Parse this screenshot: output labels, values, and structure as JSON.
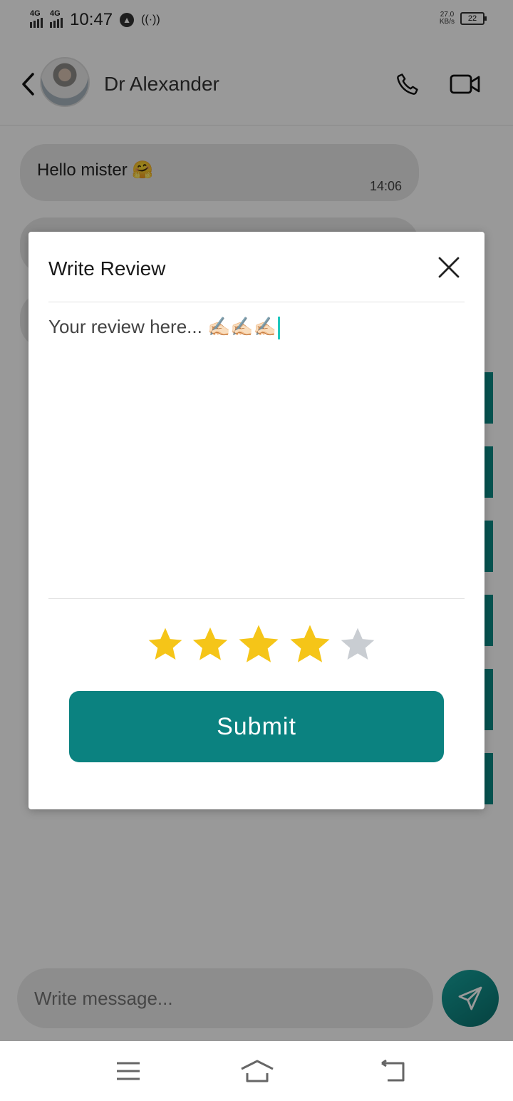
{
  "status_bar": {
    "network_1": "4G",
    "network_2": "4G",
    "time": "10:47",
    "speed_value": "27.0",
    "speed_unit": "KB/s",
    "battery": "22"
  },
  "header": {
    "contact_name": "Dr Alexander",
    "icons": [
      "back-arrow",
      "phone",
      "video-camera"
    ]
  },
  "messages": [
    {
      "text": "Hello mister 🤗",
      "time": "14:06"
    }
  ],
  "composer": {
    "placeholder": "Write message..."
  },
  "dialog": {
    "title": "Write Review",
    "review_placeholder": "Your review here... ✍🏻✍🏻✍🏻",
    "rating": 4,
    "rating_max": 5,
    "submit_label": "Submit"
  },
  "colors": {
    "accent": "#0b8280",
    "star_active": "#f5c518",
    "star_inactive": "#c9cdd2",
    "caret": "#1fc7be"
  }
}
